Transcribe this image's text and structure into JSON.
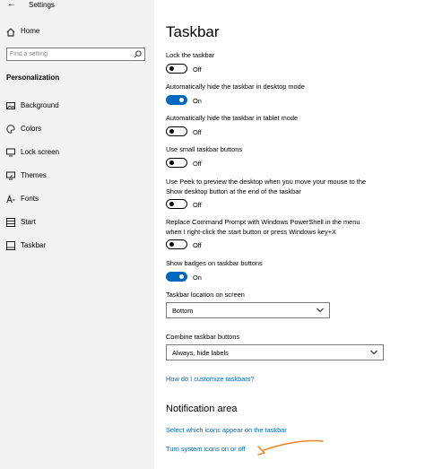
{
  "window": {
    "title": "Settings"
  },
  "sidebar": {
    "home_label": "Home",
    "search_placeholder": "Find a setting",
    "section_heading": "Personalization",
    "items": [
      {
        "label": "Background",
        "icon": "picture-icon"
      },
      {
        "label": "Colors",
        "icon": "palette-icon"
      },
      {
        "label": "Lock screen",
        "icon": "monitor-icon"
      },
      {
        "label": "Themes",
        "icon": "brush-icon"
      },
      {
        "label": "Fonts",
        "icon": "font-icon"
      },
      {
        "label": "Start",
        "icon": "start-icon"
      },
      {
        "label": "Taskbar",
        "icon": "taskbar-icon"
      }
    ]
  },
  "main": {
    "title": "Taskbar",
    "toggles": [
      {
        "label": "Lock the taskbar",
        "state": "Off",
        "on": false
      },
      {
        "label": "Automatically hide the taskbar in desktop mode",
        "state": "On",
        "on": true
      },
      {
        "label": "Automatically hide the taskbar in tablet mode",
        "state": "Off",
        "on": false
      },
      {
        "label": "Use small taskbar buttons",
        "state": "Off",
        "on": false
      },
      {
        "label": "Use Peek to preview the desktop when you move your mouse to the Show desktop button at the end of the taskbar",
        "state": "Off",
        "on": false
      },
      {
        "label": "Replace Command Prompt with Windows PowerShell in the menu when I right-click the start button or press Windows key+X",
        "state": "Off",
        "on": false
      },
      {
        "label": "Show badges on taskbar buttons",
        "state": "On",
        "on": true
      }
    ],
    "location": {
      "label": "Taskbar location on screen",
      "value": "Bottom"
    },
    "combine": {
      "label": "Combine taskbar buttons",
      "value": "Always, hide labels"
    },
    "help_link": "How do I customize taskbars?",
    "notification": {
      "heading": "Notification area",
      "link_icons": "Select which icons appear on the taskbar",
      "link_system_icons": "Turn system icons on or off"
    }
  },
  "colors": {
    "accent": "#0067c0",
    "link": "#0067b8",
    "sidebar_bg": "#f2f2f2",
    "annotation": "#f07c1a"
  }
}
